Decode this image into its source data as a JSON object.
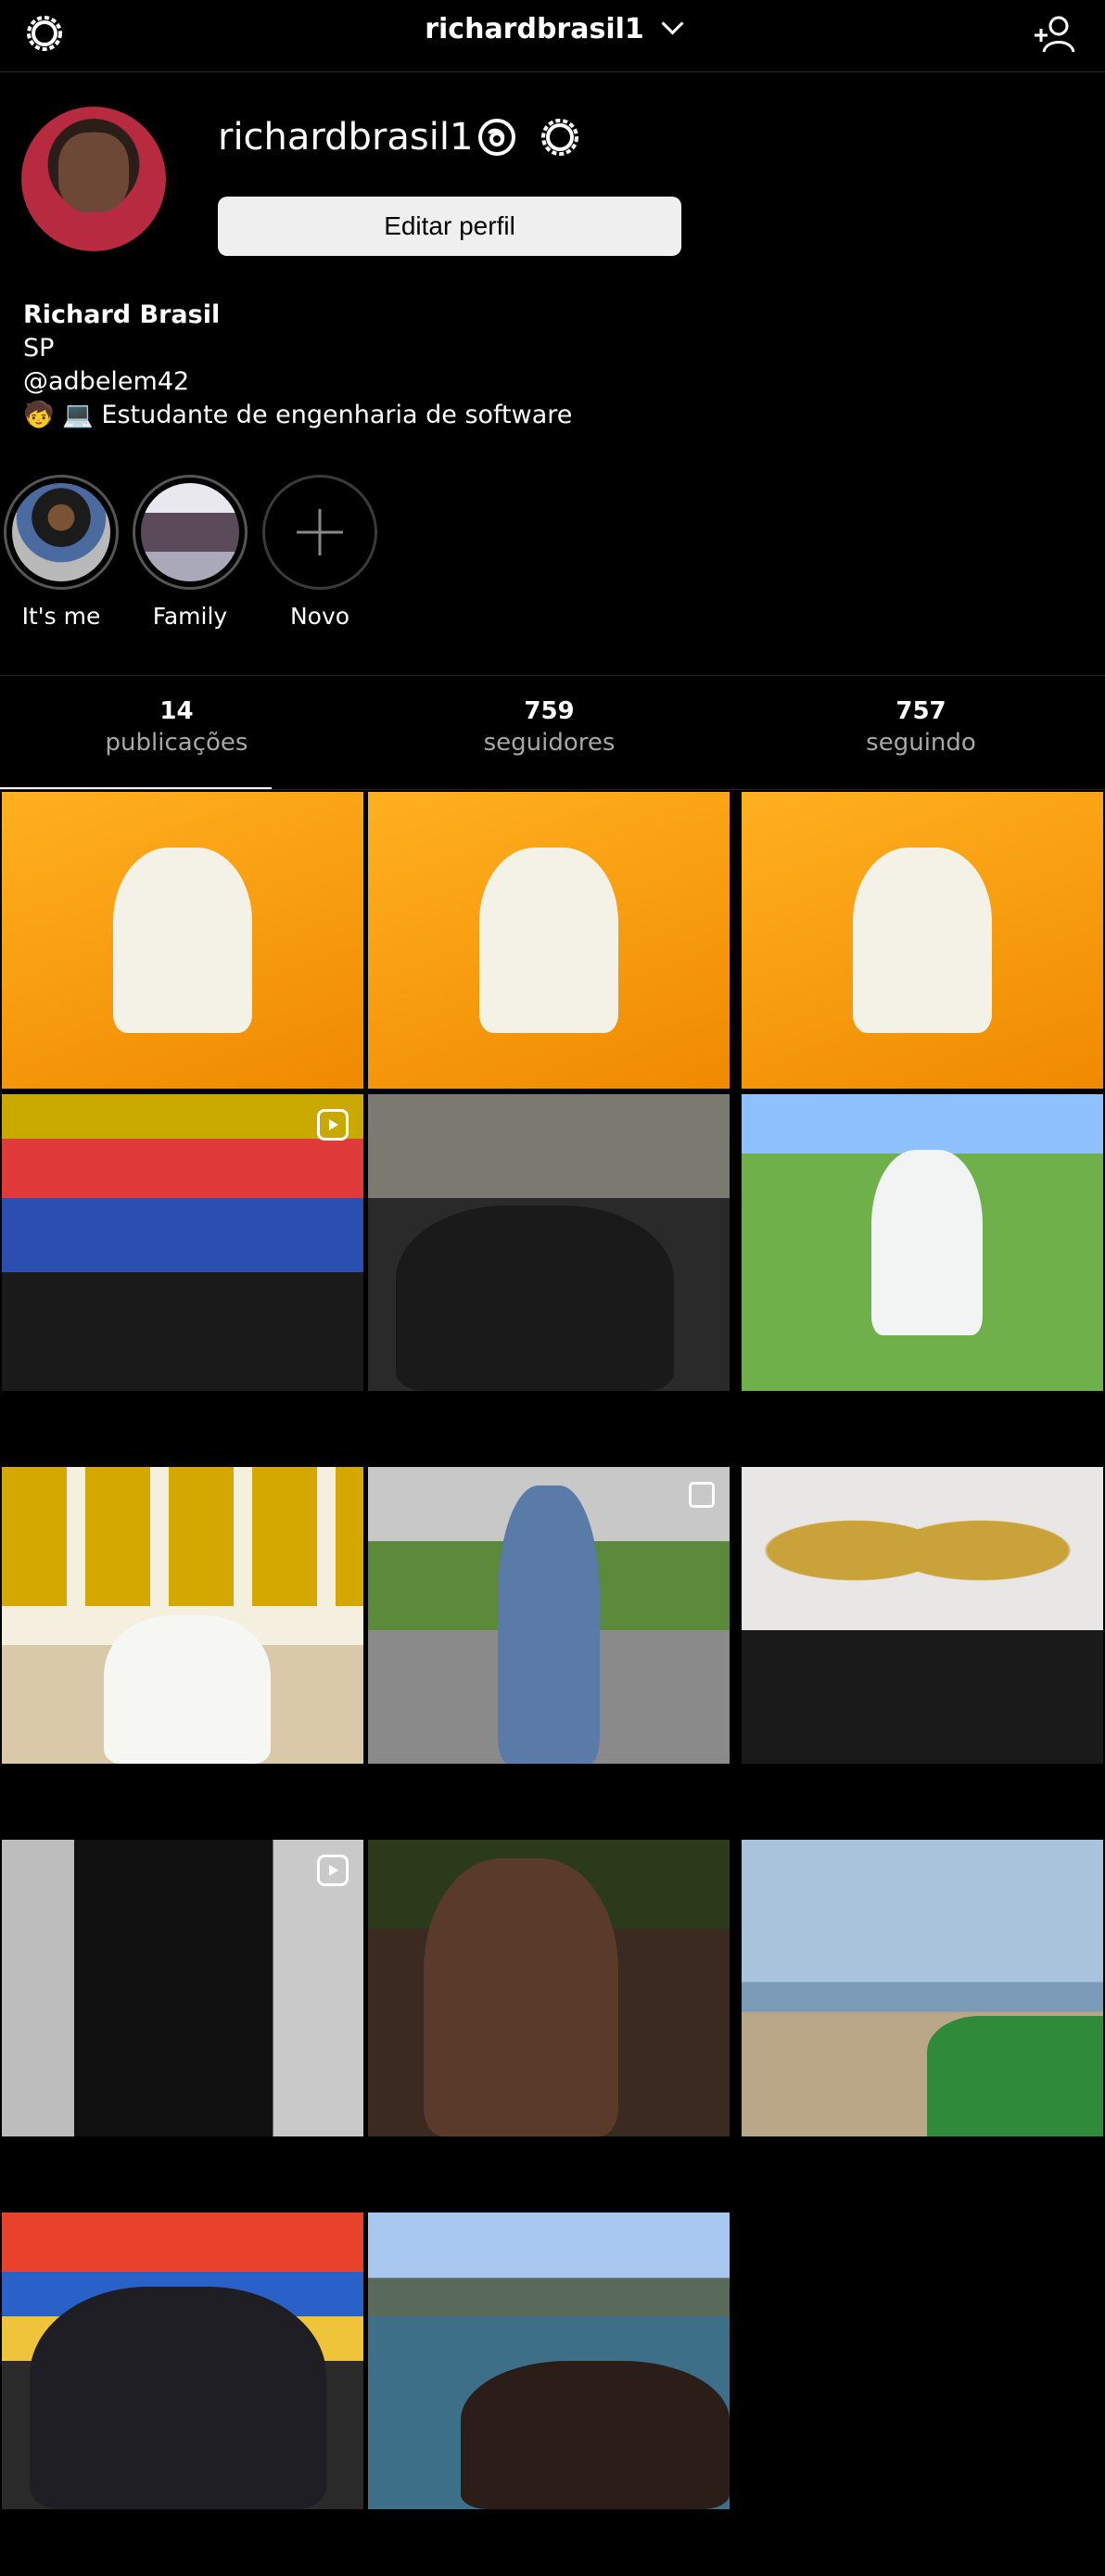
{
  "topbar": {
    "username": "richardbrasil1",
    "icons": {
      "settings": "gear-icon",
      "dropdown": "chevron-down-icon",
      "add_user": "add-user-icon"
    }
  },
  "profile": {
    "username": "richardbrasil1",
    "edit_button": "Editar perfil",
    "icons": {
      "threads": "threads-icon",
      "settings": "gear-icon"
    },
    "bio": {
      "name": "Richard Brasil",
      "line1": "SP",
      "line2": "@adbelem42",
      "line3": "🧒 💻  Estudante de engenharia de software"
    }
  },
  "highlights": [
    {
      "label": "It's me"
    },
    {
      "label": "Family"
    },
    {
      "label": "Novo"
    }
  ],
  "stats": {
    "posts": {
      "value": "14",
      "label": "publicações"
    },
    "followers": {
      "value": "759",
      "label": "seguidores"
    },
    "following": {
      "value": "757",
      "label": "seguindo"
    }
  },
  "grid": {
    "post_count": 14,
    "badges": [
      "reel-icon",
      "multi-photo-icon"
    ]
  },
  "colors": {
    "background": "#000000",
    "button": "#efefef",
    "secondary_text": "#a8a8a8",
    "divider": "#262626"
  }
}
